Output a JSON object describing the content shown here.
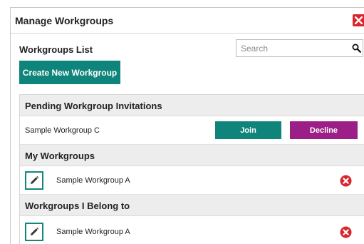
{
  "dialog": {
    "title": "Manage Workgroups",
    "close_icon": "close-icon"
  },
  "list": {
    "heading": "Workgroups List",
    "search_placeholder": "Search",
    "search_icon": "search-icon",
    "create_label": "Create New Workgroup"
  },
  "pending": {
    "heading": "Pending Workgroup Invitations",
    "items": [
      {
        "name": "Sample Workgroup C",
        "join_label": "Join",
        "decline_label": "Decline"
      }
    ]
  },
  "my_workgroups": {
    "heading": "My Workgroups",
    "items": [
      {
        "name": "Sample Workgroup A",
        "edit_icon": "pencil-icon",
        "remove_icon": "remove-circle-icon"
      }
    ]
  },
  "belong_to": {
    "heading": "Workgroups I Belong to",
    "items": [
      {
        "name": "Sample Workgroup A",
        "edit_icon": "pencil-icon",
        "remove_icon": "remove-circle-icon"
      }
    ]
  },
  "colors": {
    "teal": "#0e847a",
    "purple": "#9c1f87",
    "red": "#d9262c",
    "section_bg": "#ededed"
  }
}
